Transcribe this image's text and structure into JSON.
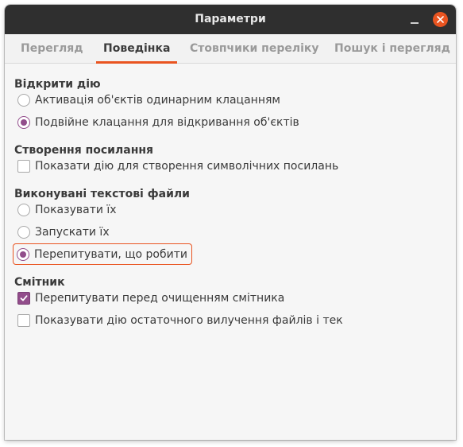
{
  "window": {
    "title": "Параметри"
  },
  "tabs": [
    {
      "label": "Перегляд",
      "active": false
    },
    {
      "label": "Поведінка",
      "active": true
    },
    {
      "label": "Стовпчики переліку",
      "active": false
    },
    {
      "label": "Пошук і перегляд",
      "active": false
    }
  ],
  "sections": {
    "open_action": {
      "title": "Відкрити дію",
      "options": [
        {
          "label": "Активація об'єктів одинарним клацанням",
          "checked": false
        },
        {
          "label": "Подвійне клацання для відкривання об'єктів",
          "checked": true
        }
      ]
    },
    "link_creation": {
      "title": "Створення посилання",
      "options": [
        {
          "label": "Показати дію для створення символічних посилань",
          "checked": false
        }
      ]
    },
    "executable_text": {
      "title": "Виконувані текстові файли",
      "options": [
        {
          "label": "Показувати їх",
          "checked": false
        },
        {
          "label": "Запускати їх",
          "checked": false
        },
        {
          "label": "Перепитувати, що робити",
          "checked": true
        }
      ]
    },
    "trash": {
      "title": "Смітник",
      "options": [
        {
          "label": "Перепитувати перед очищенням смітника",
          "checked": true
        },
        {
          "label": "Показувати дію остаточного вилучення файлів і тек",
          "checked": false
        }
      ]
    }
  },
  "colors": {
    "accent": "#e95420",
    "check": "#924d8b",
    "titlebar": "#2f2f2f"
  }
}
